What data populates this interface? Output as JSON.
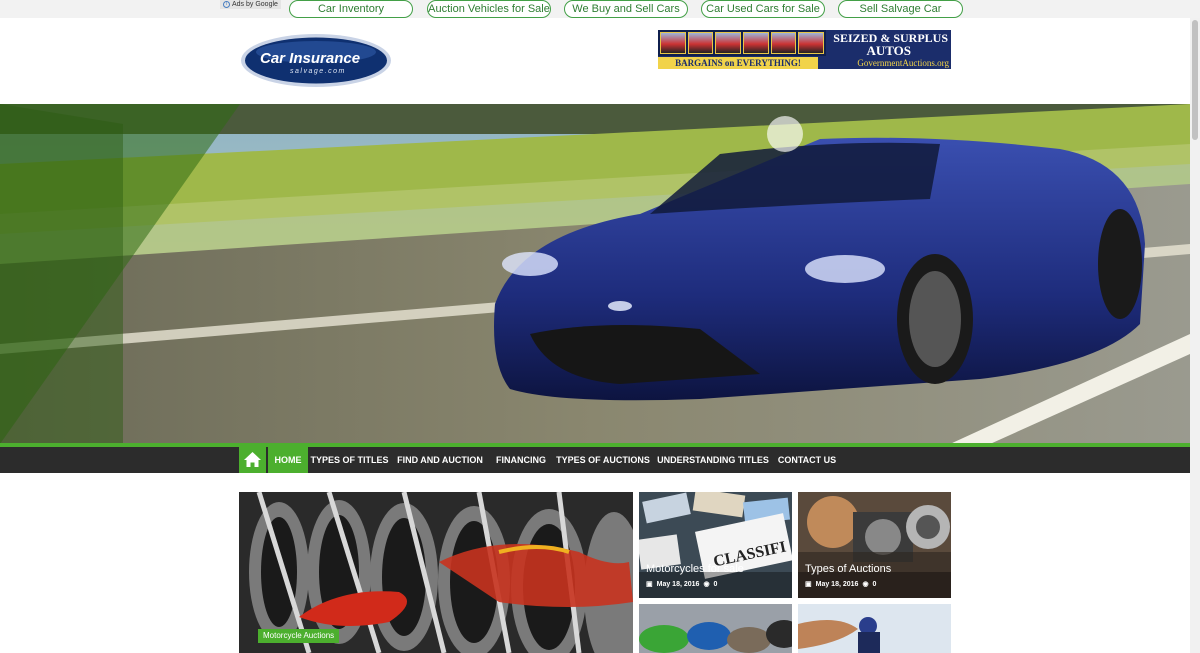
{
  "ad_bar": {
    "ads_label": "Ads by Google",
    "links": [
      "Car Inventory",
      "Auction Vehicles for Sale",
      "We Buy and Sell Cars",
      "Car Used Cars for Sale",
      "Sell Salvage Car"
    ]
  },
  "header": {
    "logo_line1": "Car Insurance",
    "logo_line2": "salvage.com",
    "banner": {
      "title_line1": "SEIZED & SURPLUS",
      "title_line2": "AUTOS",
      "tagline": "BARGAINS on EVERYTHING!",
      "site": "GovernmentAuctions.org"
    }
  },
  "nav": {
    "items": [
      "HOME",
      "TYPES OF TITLES",
      "FIND AND AUCTION",
      "FINANCING",
      "TYPES OF AUCTIONS",
      "UNDERSTANDING TITLES",
      "CONTACT US"
    ],
    "active": "HOME"
  },
  "posts": [
    {
      "category": "Motorcycle Auctions"
    },
    {
      "title": "Motorcycles for sale",
      "date": "May 18, 2016",
      "comments": "0"
    },
    {
      "title": "Types of Auctions",
      "date": "May 18, 2016",
      "comments": "0"
    }
  ],
  "colors": {
    "accent": "#4caf2e",
    "nav_bg": "#2c2c2c",
    "ad_link": "#2e7d32"
  }
}
